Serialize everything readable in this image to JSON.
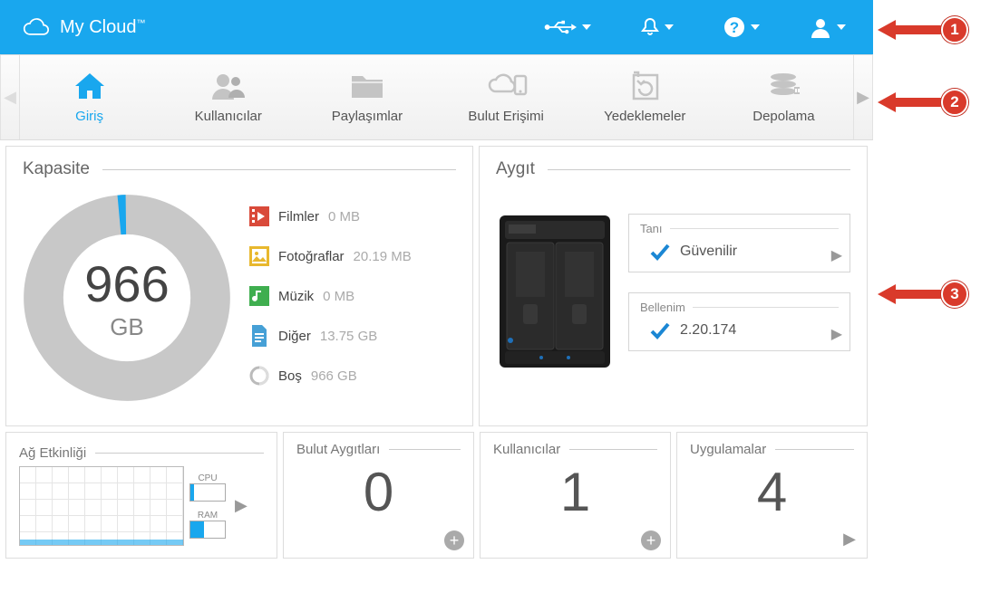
{
  "header": {
    "brand": "My Cloud"
  },
  "nav": {
    "items": [
      {
        "label": "Giriş"
      },
      {
        "label": "Kullanıcılar"
      },
      {
        "label": "Paylaşımlar"
      },
      {
        "label": "Bulut Erişimi"
      },
      {
        "label": "Yedeklemeler"
      },
      {
        "label": "Depolama"
      }
    ]
  },
  "capacity": {
    "title": "Kapasite",
    "value": "966",
    "unit": "GB",
    "items": [
      {
        "label": "Filmler",
        "value": "0 MB"
      },
      {
        "label": "Fotoğraflar",
        "value": "20.19 MB"
      },
      {
        "label": "Müzik",
        "value": "0 MB"
      },
      {
        "label": "Diğer",
        "value": "13.75 GB"
      },
      {
        "label": "Boş",
        "value": "966 GB"
      }
    ]
  },
  "device": {
    "title": "Aygıt",
    "diag_label": "Tanı",
    "diag_value": "Güvenilir",
    "fw_label": "Bellenim",
    "fw_value": "2.20.174"
  },
  "row2": {
    "network_title": "Ağ Etkinliği",
    "cpu_label": "CPU",
    "ram_label": "RAM",
    "cloud_devices_title": "Bulut Aygıtları",
    "cloud_devices_value": "0",
    "users_title": "Kullanıcılar",
    "users_value": "1",
    "apps_title": "Uygulamalar",
    "apps_value": "4"
  },
  "annotations": {
    "a1": "1",
    "a2": "2",
    "a3": "3"
  }
}
